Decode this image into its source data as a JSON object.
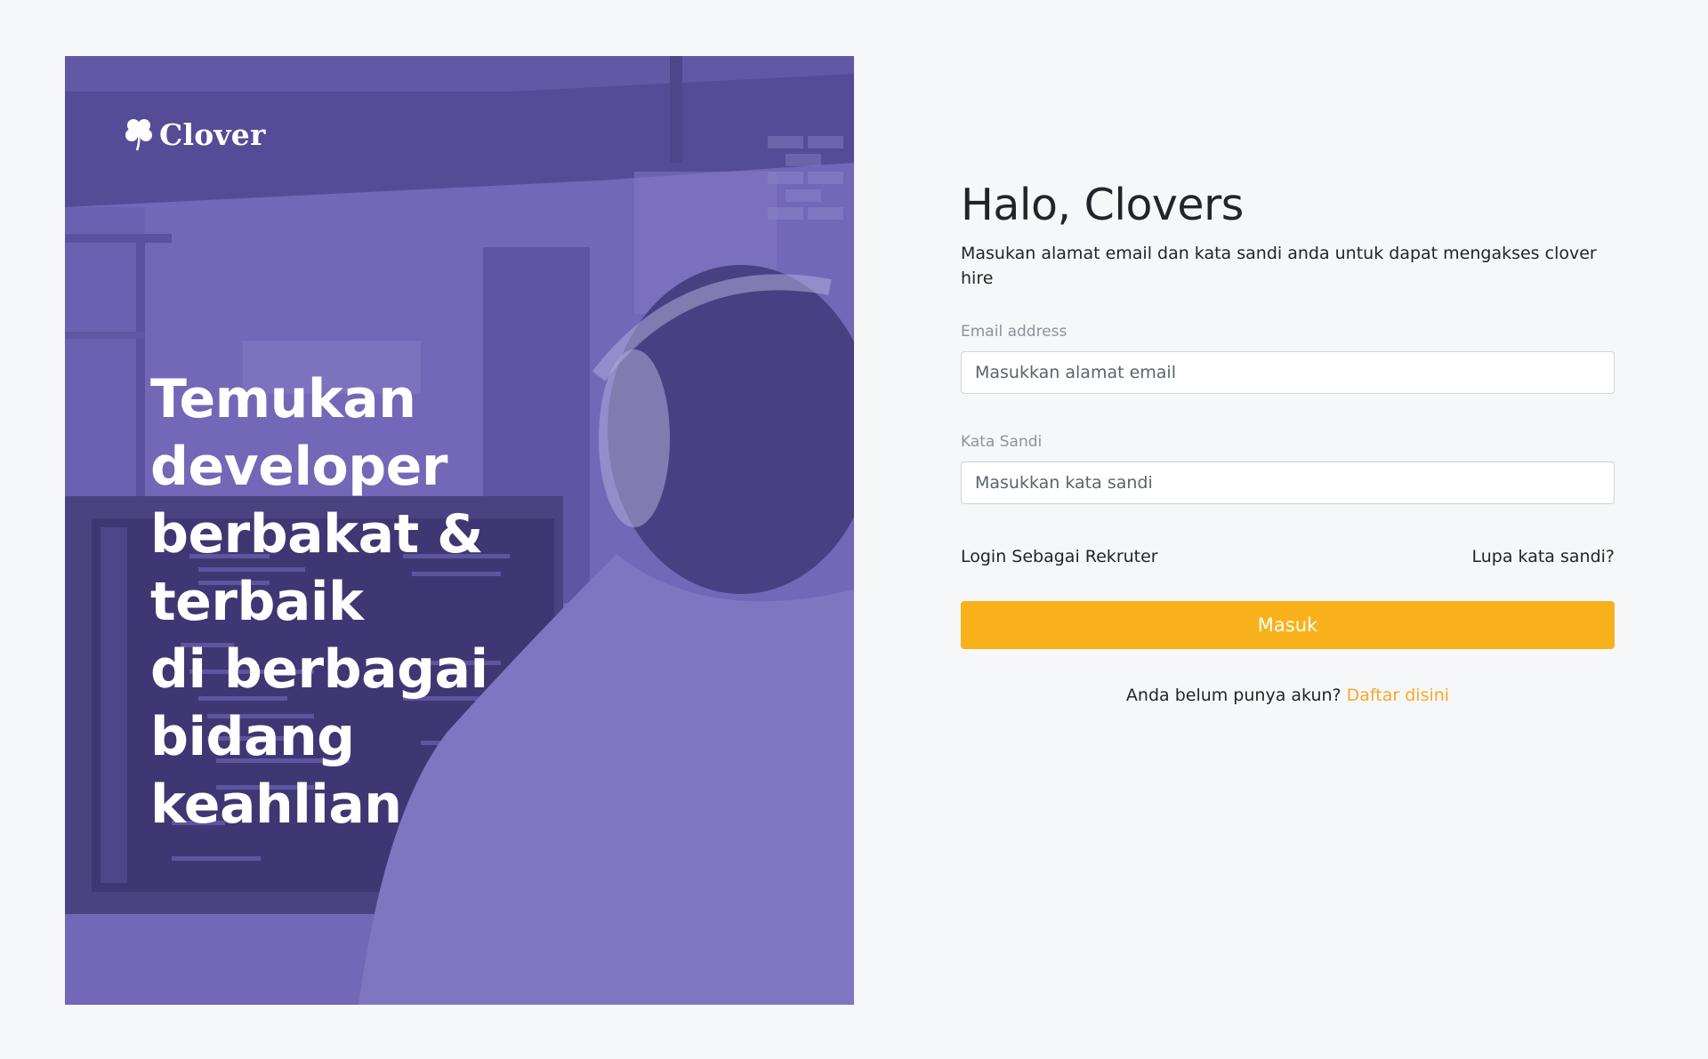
{
  "hero": {
    "logo_text": "Clover",
    "logo_icon": "clover-icon",
    "headline_lines": [
      "Temukan developer",
      "berbakat & terbaik",
      "di berbagai bidang",
      "keahlian"
    ],
    "overlay_color": "#6f64b6"
  },
  "form": {
    "title": "Halo, Clovers",
    "subtitle": "Masukan alamat email dan kata sandi anda untuk dapat mengakses clover hire",
    "email": {
      "label": "Email address",
      "placeholder": "Masukkan alamat email",
      "value": ""
    },
    "password": {
      "label": "Kata Sandi",
      "placeholder": "Masukkan kata sandi",
      "value": ""
    },
    "recruiter_link": "Login Sebagai Rekruter",
    "forgot_link": "Lupa kata sandi?",
    "submit_label": "Masuk",
    "signup_prompt": "Anda belum punya akun?",
    "signup_link": "Daftar disini"
  },
  "colors": {
    "accent": "#f9b11b",
    "link_accent": "#f9a825",
    "page_background": "#f6f7f9"
  }
}
